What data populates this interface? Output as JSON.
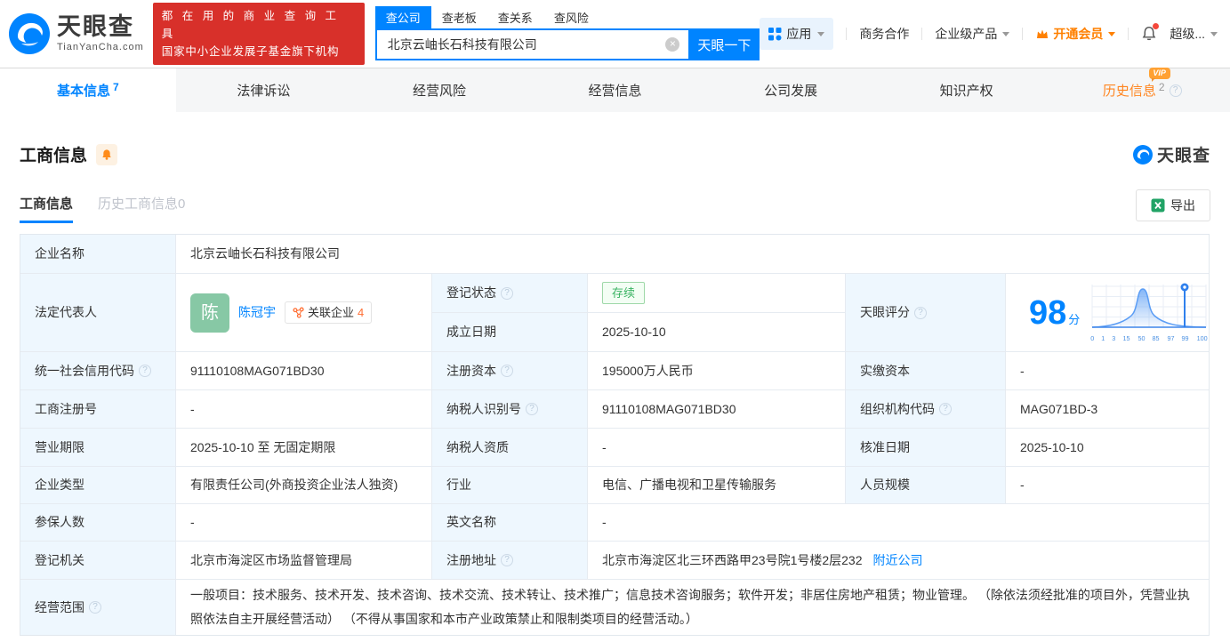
{
  "header": {
    "brand": {
      "name": "天眼查",
      "domain": "TianYanCha.com"
    },
    "promo": {
      "line1": "都 在 用 的 商 业 查 询 工 具",
      "line2": "国家中小企业发展子基金旗下机构"
    },
    "search": {
      "tabs": [
        "查公司",
        "查老板",
        "查关系",
        "查风险"
      ],
      "value": "北京云岫长石科技有限公司",
      "button_label": "天眼一下"
    },
    "nav": {
      "apps": "应用",
      "cooperation": "商务合作",
      "enterprise": "企业级产品",
      "membership": "开通会员",
      "user": "超级..."
    }
  },
  "main_tabs": [
    {
      "label": "基本信息",
      "count": "7"
    },
    {
      "label": "法律诉讼",
      "count": ""
    },
    {
      "label": "经营风险",
      "count": ""
    },
    {
      "label": "经营信息",
      "count": ""
    },
    {
      "label": "公司发展",
      "count": ""
    },
    {
      "label": "知识产权",
      "count": ""
    },
    {
      "label": "历史信息",
      "count": "2",
      "vip": "VIP"
    }
  ],
  "section": {
    "title": "工商信息",
    "subtabs": [
      "工商信息",
      "历史工商信息0"
    ],
    "export_label": "导出",
    "watermark": "天眼查"
  },
  "table": {
    "company_name": {
      "label": "企业名称",
      "value": "北京云岫长石科技有限公司"
    },
    "legal_rep": {
      "label": "法定代表人",
      "avatar": "陈",
      "name": "陈冠宇",
      "badge": "关联企业",
      "badge_count": "4"
    },
    "reg_status": {
      "label": "登记状态",
      "value": "存续"
    },
    "est_date": {
      "label": "成立日期",
      "value": "2025-10-10"
    },
    "score": {
      "label": "天眼评分",
      "value": "98",
      "unit": "分",
      "axis": [
        "0",
        "1",
        "3",
        "15",
        "50",
        "85",
        "97",
        "99",
        "100"
      ]
    },
    "credit_code": {
      "label": "统一社会信用代码",
      "value": "91110108MAG071BD30"
    },
    "reg_capital": {
      "label": "注册资本",
      "value": "195000万人民币"
    },
    "paid_capital": {
      "label": "实缴资本",
      "value": "-"
    },
    "reg_number": {
      "label": "工商注册号",
      "value": "-"
    },
    "taxpayer_id": {
      "label": "纳税人识别号",
      "value": "91110108MAG071BD30"
    },
    "org_code": {
      "label": "组织机构代码",
      "value": "MAG071BD-3"
    },
    "biz_term": {
      "label": "营业期限",
      "value": "2025-10-10 至 无固定期限"
    },
    "taxpayer_quality": {
      "label": "纳税人资质",
      "value": "-"
    },
    "approval_date": {
      "label": "核准日期",
      "value": "2025-10-10"
    },
    "company_type": {
      "label": "企业类型",
      "value": "有限责任公司(外商投资企业法人独资)"
    },
    "industry": {
      "label": "行业",
      "value": "电信、广播电视和卫星传输服务"
    },
    "staff_size": {
      "label": "人员规模",
      "value": "-"
    },
    "insured_count": {
      "label": "参保人数",
      "value": "-"
    },
    "english_name": {
      "label": "英文名称",
      "value": "-"
    },
    "reg_authority": {
      "label": "登记机关",
      "value": "北京市海淀区市场监督管理局"
    },
    "reg_address": {
      "label": "注册地址",
      "value": "北京市海淀区北三环西路甲23号院1号楼2层232",
      "link": "附近公司"
    },
    "business_scope": {
      "label": "经营范围",
      "value": "一般项目：技术服务、技术开发、技术咨询、技术交流、技术转让、技术推广；信息技术咨询服务；软件开发；非居住房地产租赁；物业管理。 （除依法须经批准的项目外，凭营业执照依法自主开展经营活动） （不得从事国家和本市产业政策禁止和限制类项目的经营活动。）"
    }
  }
}
